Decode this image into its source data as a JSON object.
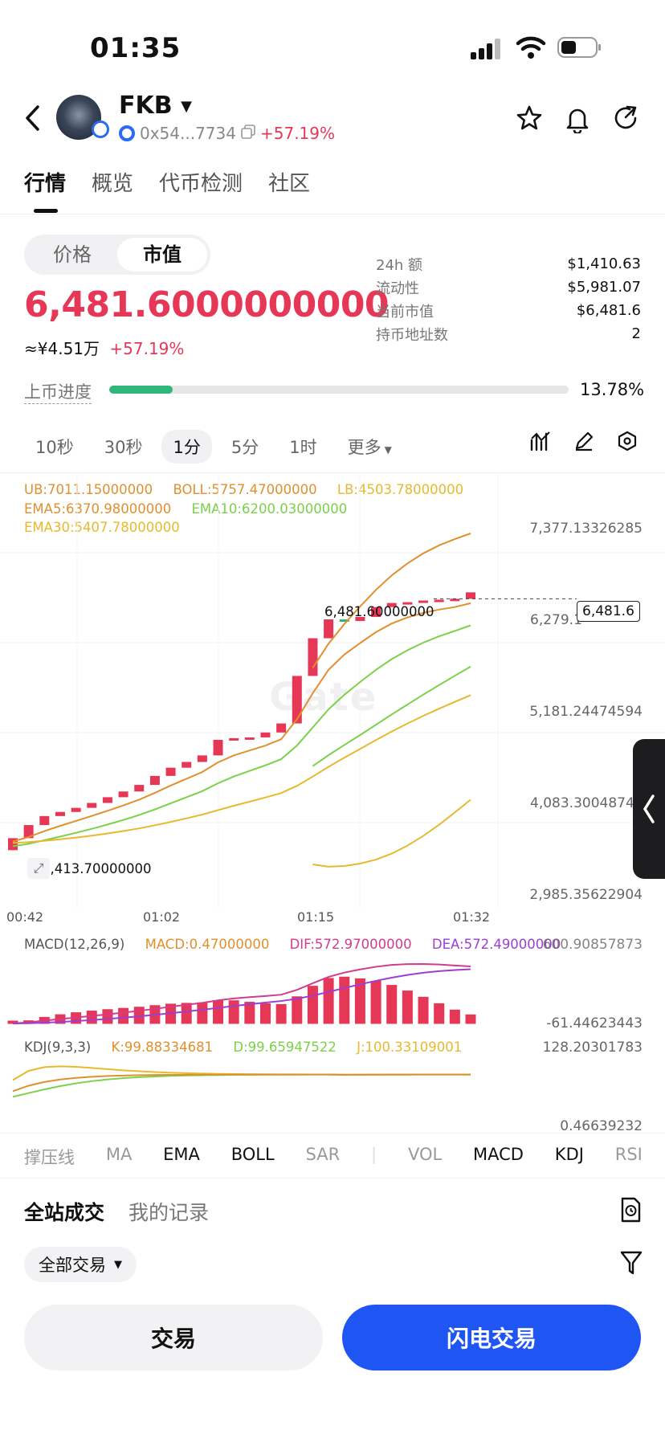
{
  "status_bar": {
    "time": "01:35"
  },
  "header": {
    "back_icon": "chevron-left-icon",
    "token_name": "FKB",
    "address": "0x54...7734",
    "change": "+57.19%",
    "actions": [
      "star-icon",
      "bell-icon",
      "share-icon"
    ]
  },
  "tabs": [
    "行情",
    "概览",
    "代币检测",
    "社区"
  ],
  "mode_toggle": {
    "options": [
      "价格",
      "市值"
    ],
    "selected": "市值"
  },
  "market_cap": {
    "value": "6,481.6000000000",
    "cny": "≈¥4.51万",
    "change": "+57.19%"
  },
  "stats": [
    {
      "label": "24h  额",
      "value": "$1,410.63"
    },
    {
      "label": "流动性",
      "value": "$5,981.07"
    },
    {
      "label": "当前市值",
      "value": "$6,481.6"
    },
    {
      "label": "持币地址数",
      "value": "2"
    }
  ],
  "progress": {
    "label": "上币进度",
    "percent_text": "13.78%",
    "fraction": 0.1378
  },
  "timeframes": {
    "options": [
      "10秒",
      "30秒",
      "1分",
      "5分",
      "1时",
      "更多"
    ],
    "selected": "1分"
  },
  "chart": {
    "legend_main": [
      {
        "text": "UB:7011.15000000",
        "color": "#e0902e"
      },
      {
        "text": "BOLL:5757.47000000",
        "color": "#e0902e"
      },
      {
        "text": "LB:4503.78000000",
        "color": "#e8b92e"
      },
      {
        "text": "EMA5:6370.98000000",
        "color": "#e0902e"
      },
      {
        "text": "EMA10:6200.03000000",
        "color": "#7bd14a"
      },
      {
        "text": "EMA30:5407.78000000",
        "color": "#e8b92e"
      }
    ],
    "price_axis": [
      "7,377.13326285",
      "6,279.1",
      "5,181.24474594",
      "4,083.3004874",
      "2,985.35622904"
    ],
    "last_price_tag": "6,481.6",
    "high_label": "6,481.60000000",
    "low_label": "3,413.70000000",
    "time_axis": [
      "00:42",
      "01:02",
      "01:15",
      "01:32"
    ],
    "watermark": "Gate",
    "macd_legend": [
      {
        "text": "MACD(12,26,9)",
        "color": "#555555"
      },
      {
        "text": "MACD:0.47000000",
        "color": "#e0902e"
      },
      {
        "text": "DIF:572.97000000",
        "color": "#d23c8c"
      },
      {
        "text": "DEA:572.49000000",
        "color": "#9b3fd1"
      }
    ],
    "macd_axis": [
      "600.90857873",
      "-61.44623443"
    ],
    "kdj_legend": [
      {
        "text": "KDJ(9,3,3)",
        "color": "#555555"
      },
      {
        "text": "K:99.88334681",
        "color": "#e0902e"
      },
      {
        "text": "D:99.65947522",
        "color": "#7bd14a"
      },
      {
        "text": "J:100.33109001",
        "color": "#e8b92e"
      }
    ],
    "kdj_axis": [
      "128.20301783",
      "0.46639232"
    ],
    "colors": {
      "up": "#e63757",
      "down": "#2fb67a"
    }
  },
  "chart_data": {
    "type": "candlestick",
    "price_range": [
      2985.35622904,
      7377.13326285
    ],
    "candles": [
      {
        "o": 3413.7,
        "c": 3560
      },
      {
        "o": 3560,
        "c": 3720
      },
      {
        "o": 3720,
        "c": 3830
      },
      {
        "o": 3830,
        "c": 3880
      },
      {
        "o": 3880,
        "c": 3930
      },
      {
        "o": 3930,
        "c": 3990
      },
      {
        "o": 3990,
        "c": 4060
      },
      {
        "o": 4060,
        "c": 4130
      },
      {
        "o": 4130,
        "c": 4210
      },
      {
        "o": 4210,
        "c": 4320
      },
      {
        "o": 4320,
        "c": 4420
      },
      {
        "o": 4420,
        "c": 4490
      },
      {
        "o": 4490,
        "c": 4570
      },
      {
        "o": 4570,
        "c": 4760
      },
      {
        "o": 4760,
        "c": 4780
      },
      {
        "o": 4780,
        "c": 4790
      },
      {
        "o": 4790,
        "c": 4850
      },
      {
        "o": 4850,
        "c": 4960
      },
      {
        "o": 4960,
        "c": 5540
      },
      {
        "o": 5540,
        "c": 6000
      },
      {
        "o": 6000,
        "c": 6230
      },
      {
        "o": 6230,
        "c": 6210
      },
      {
        "o": 6210,
        "c": 6260
      },
      {
        "o": 6260,
        "c": 6380
      },
      {
        "o": 6380,
        "c": 6430
      },
      {
        "o": 6430,
        "c": 6440
      },
      {
        "o": 6440,
        "c": 6460
      },
      {
        "o": 6460,
        "c": 6470
      },
      {
        "o": 6470,
        "c": 6481.6
      },
      {
        "o": 6481.6,
        "c": 6560
      }
    ],
    "ub": [
      7011.15
    ],
    "boll": [
      5757.47
    ],
    "lb": [
      4503.78
    ],
    "ema5": [
      6370.98
    ],
    "ema10": [
      6200.03
    ],
    "ema30": [
      5407.78
    ]
  },
  "indicators": {
    "items": [
      "撑压线",
      "MA",
      "EMA",
      "BOLL",
      "SAR",
      "VOL",
      "MACD",
      "KDJ",
      "RSI"
    ],
    "active": [
      "EMA",
      "BOLL",
      "MACD",
      "KDJ"
    ]
  },
  "records": {
    "tabs": [
      "全站成交",
      "我的记录"
    ],
    "filter_chip": "全部交易"
  },
  "buttons": {
    "trade": "交易",
    "flash_trade": "闪电交易"
  }
}
